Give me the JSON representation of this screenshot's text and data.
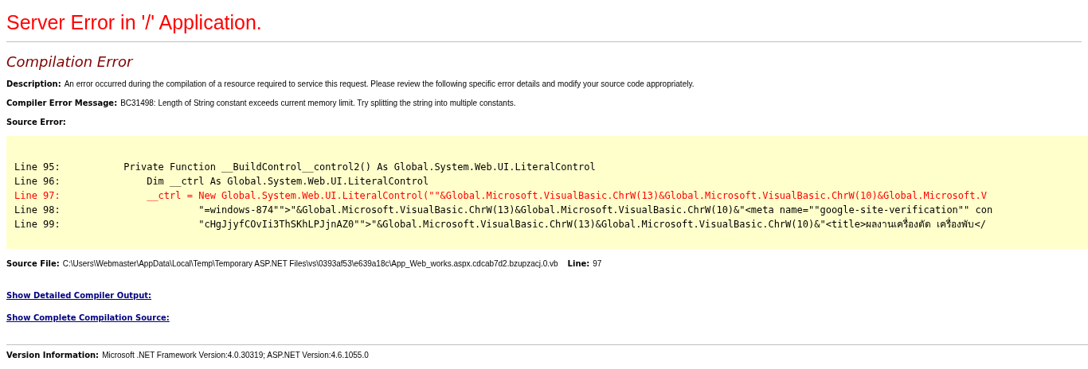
{
  "title": "Server Error in '/' Application.",
  "heading": "Compilation Error",
  "fields": [
    {
      "label": "Description:",
      "value": "An error occurred during the compilation of a resource required to service this request. Please review the following specific error details and modify your source code appropriately."
    },
    {
      "label": "Compiler Error Message:",
      "value": "BC31498: Length of String constant exceeds current memory limit. Try splitting the string into multiple constants."
    },
    {
      "label": "Source Error:"
    }
  ],
  "source_lines": [
    {
      "label": "Line 95:",
      "code": "Private Function __BuildControl__control2() As Global.System.Web.UI.LiteralControl",
      "error": false
    },
    {
      "label": "Line 96:",
      "code": "    Dim __ctrl As Global.System.Web.UI.LiteralControl",
      "error": false
    },
    {
      "label": "Line 97:",
      "code": "    __ctrl = New Global.System.Web.UI.LiteralControl(\"\"&Global.Microsoft.VisualBasic.ChrW(13)&Global.Microsoft.VisualBasic.ChrW(10)&Global.Microsoft.V",
      "error": true
    },
    {
      "label": "Line 98:",
      "code": "             \"=windows-874\"\">\"&Global.Microsoft.VisualBasic.ChrW(13)&Global.Microsoft.VisualBasic.ChrW(10)&\"<meta name=\"\"google-site-verification\"\" con",
      "error": false
    },
    {
      "label": "Line 99:",
      "code": "             \"cHgJjyfCOvIi3ThSKhLPJjnAZ0\"\">\"&Global.Microsoft.VisualBasic.ChrW(13)&Global.Microsoft.VisualBasic.ChrW(10)&\"<title>ผลงานเครื่องตัด เครื่องพับ</",
      "error": false
    }
  ],
  "source_file": {
    "label": "Source File:",
    "path": "C:\\Users\\Webmaster\\AppData\\Local\\Temp\\Temporary ASP.NET Files\\vs\\0393af53\\e639a18c\\App_Web_works.aspx.cdcab7d2.bzupzacj.0.vb",
    "line_label": "Line:",
    "line": "97"
  },
  "links": [
    "Show Detailed Compiler Output:",
    "Show Complete Compilation Source:"
  ],
  "version": {
    "label": "Version Information:",
    "value": "Microsoft .NET Framework Version:4.0.30319; ASP.NET Version:4.6.1055.0"
  }
}
